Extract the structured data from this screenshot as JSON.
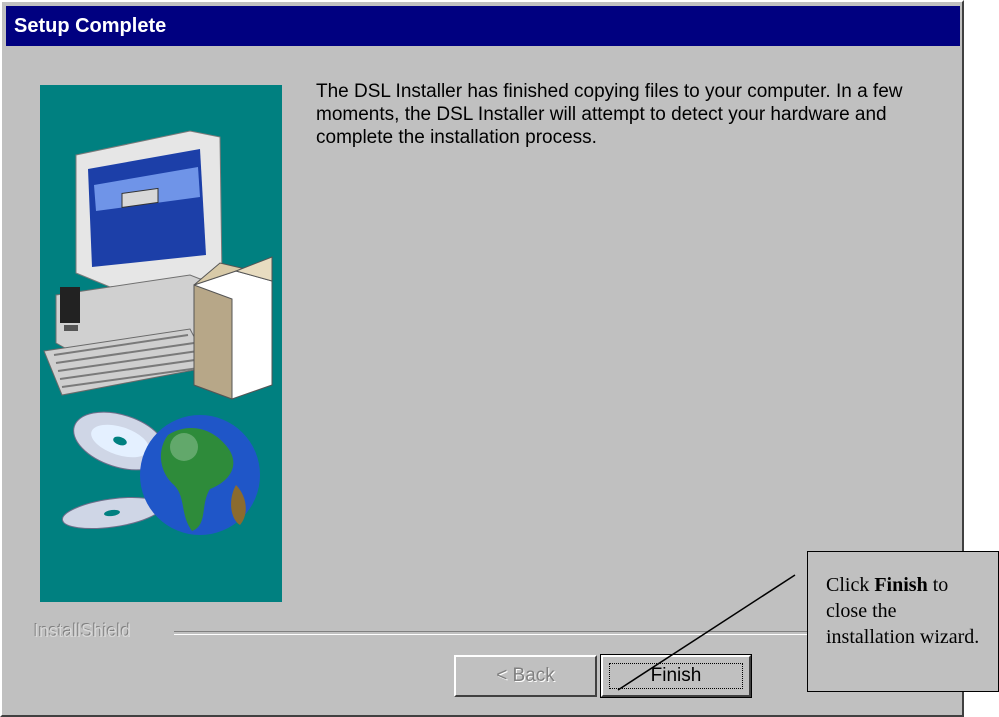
{
  "window": {
    "title": "Setup Complete"
  },
  "message": "The DSL Installer has finished copying files to your computer.  In a few moments, the DSL Installer will attempt to detect your hardware and complete the installation process.",
  "branding": "InstallShield",
  "buttons": {
    "back": "< Back",
    "finish": "Finish"
  },
  "callout": {
    "prefix": "Click ",
    "bold": "Finish",
    "suffix": " to close the installation wizard."
  },
  "colors": {
    "title_bar": "#000080",
    "dialog_bg": "#c0c0c0",
    "art_panel": "#008080"
  },
  "icons": [
    "computer-illustration",
    "software-box",
    "cd-disc",
    "globe"
  ]
}
